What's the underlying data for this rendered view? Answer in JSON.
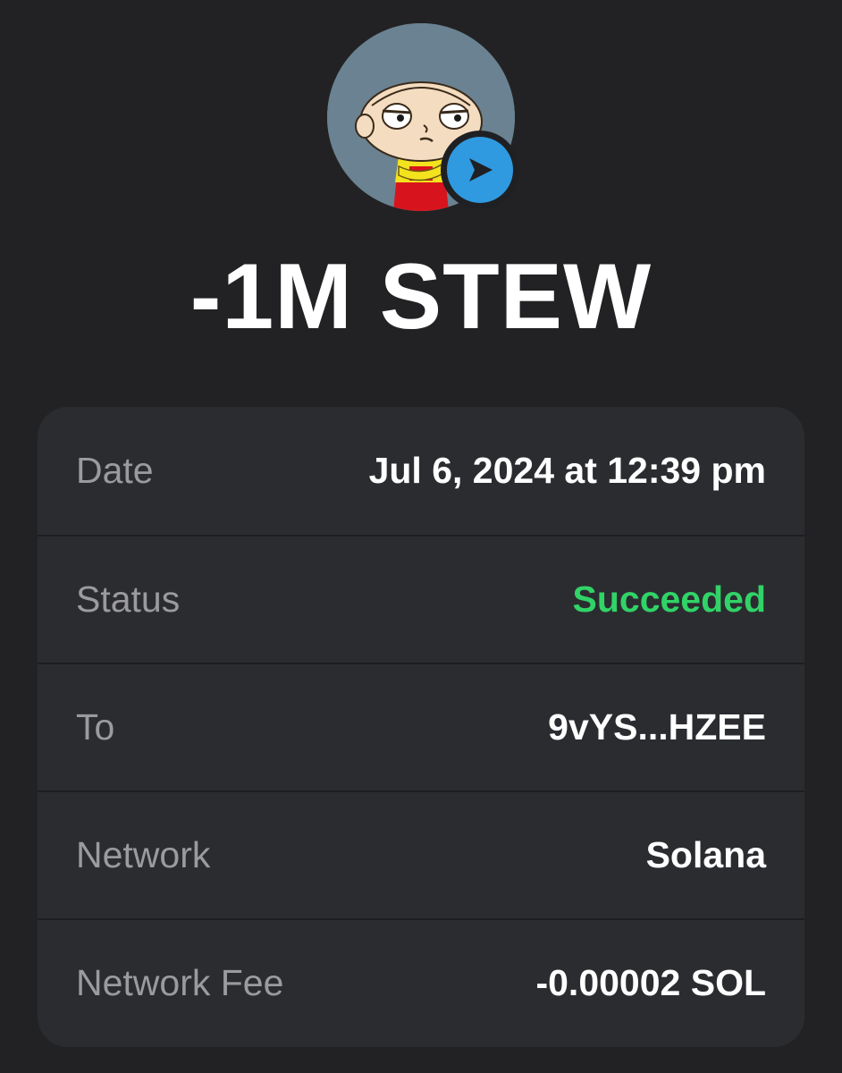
{
  "token": {
    "icon": "stewie-avatar",
    "badge_icon": "send-arrow-icon",
    "badge_color": "#2f9ae0"
  },
  "amount": "-1M STEW",
  "details": {
    "date": {
      "label": "Date",
      "value": "Jul 6, 2024 at 12:39 pm"
    },
    "status": {
      "label": "Status",
      "value": "Succeeded",
      "color": "#31d367"
    },
    "to": {
      "label": "To",
      "value": "9vYS...HZEE"
    },
    "network": {
      "label": "Network",
      "value": "Solana"
    },
    "network_fee": {
      "label": "Network Fee",
      "value": "-0.00002 SOL"
    }
  },
  "colors": {
    "background": "#222224",
    "card": "#2b2c30",
    "label": "#9a9a9f",
    "value": "#ffffff"
  }
}
